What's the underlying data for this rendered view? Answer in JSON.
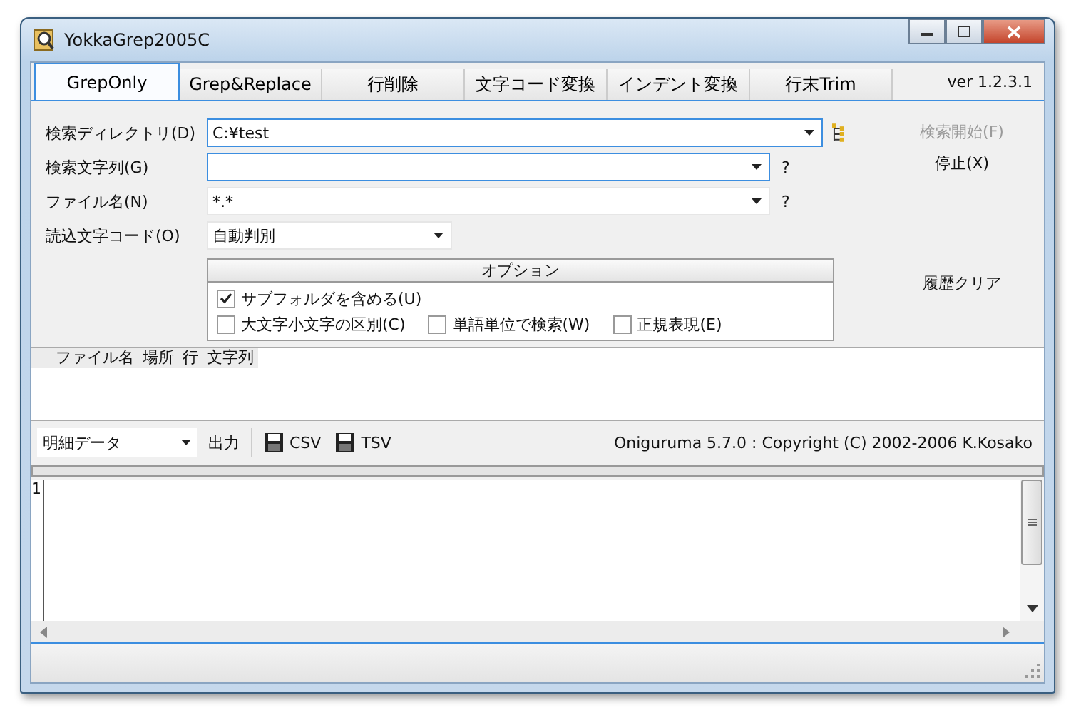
{
  "window": {
    "title": "YokkaGrep2005C"
  },
  "tabs": [
    {
      "label": "GrepOnly",
      "selected": true
    },
    {
      "label": "Grep&Replace",
      "selected": false
    },
    {
      "label": "行削除",
      "selected": false
    },
    {
      "label": "文字コード変換",
      "selected": false
    },
    {
      "label": "インデント変換",
      "selected": false
    },
    {
      "label": "行末Trim",
      "selected": false
    }
  ],
  "version": "ver 1.2.3.1",
  "fields": [
    {
      "label": "検索ディレクトリ(D)",
      "value": "C:¥test",
      "kind": "folder",
      "focused": true
    },
    {
      "label": "検索文字列(G)",
      "kind": "help",
      "help": "?",
      "focused": true
    },
    {
      "label": "ファイル名(N)",
      "value": "*.*",
      "kind": "help",
      "help": "?",
      "focused": false
    },
    {
      "label": "読込文字コード(O)",
      "value": "自動判別",
      "kind": "short",
      "focused": false
    }
  ],
  "side_buttons": [
    {
      "label": "検索開始(F)",
      "disabled": true
    },
    {
      "label": "停止(X)",
      "disabled": false
    },
    {
      "label": "履歴クリア",
      "disabled": false
    }
  ],
  "options": {
    "title": "オプション",
    "checkboxes": [
      {
        "label": "サブフォルダを含める(U)",
        "checked": true
      },
      {
        "label": "大文字小文字の区別(C)",
        "checked": false
      },
      {
        "label": "単語単位で検索(W)",
        "checked": false
      },
      {
        "label": "正規表現(E)",
        "checked": false
      }
    ]
  },
  "results": {
    "columns": [
      "ファイル名",
      "場所",
      "行",
      "文字列"
    ]
  },
  "toolbar": {
    "mode": "明細データ",
    "output": "出力",
    "exports": [
      "CSV",
      "TSV"
    ],
    "copyright": "Oniguruma 5.7.0 : Copyright (C) 2002-2006 K.Kosako"
  },
  "editor": {
    "line_numbers": [
      "1"
    ]
  }
}
